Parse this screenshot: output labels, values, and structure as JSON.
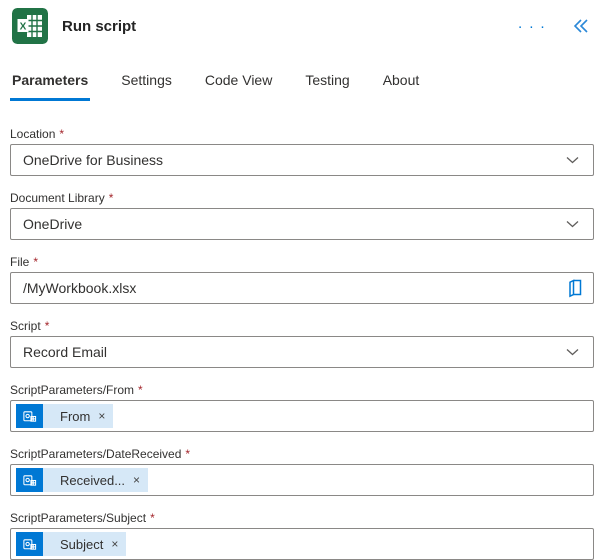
{
  "header": {
    "title": "Run script",
    "more_glyph": "· · ·"
  },
  "tabs": [
    {
      "label": "Parameters",
      "active": true
    },
    {
      "label": "Settings",
      "active": false
    },
    {
      "label": "Code View",
      "active": false
    },
    {
      "label": "Testing",
      "active": false
    },
    {
      "label": "About",
      "active": false
    }
  ],
  "ui": {
    "required_marker": "*",
    "remove_glyph": "×"
  },
  "fields": [
    {
      "label": "Location",
      "required": true,
      "type": "dropdown",
      "value": "OneDrive for Business"
    },
    {
      "label": "Document Library",
      "required": true,
      "type": "dropdown",
      "value": "OneDrive"
    },
    {
      "label": "File",
      "required": true,
      "type": "file-picker",
      "value": "/MyWorkbook.xlsx"
    },
    {
      "label": "Script",
      "required": true,
      "type": "dropdown",
      "value": "Record Email"
    },
    {
      "label": "ScriptParameters/From",
      "required": true,
      "type": "token",
      "token_text": "From",
      "token_icon": "outlook-icon"
    },
    {
      "label": "ScriptParameters/DateReceived",
      "required": true,
      "type": "token",
      "token_text": "Received...",
      "token_icon": "outlook-icon"
    },
    {
      "label": "ScriptParameters/Subject",
      "required": true,
      "type": "token",
      "token_text": "Subject",
      "token_icon": "outlook-icon"
    }
  ],
  "colors": {
    "accent_blue": "#0078d4",
    "excel_green": "#217346",
    "token_bg": "#d6e8f7",
    "required_red": "#a4262c",
    "input_border": "#8a8886"
  }
}
